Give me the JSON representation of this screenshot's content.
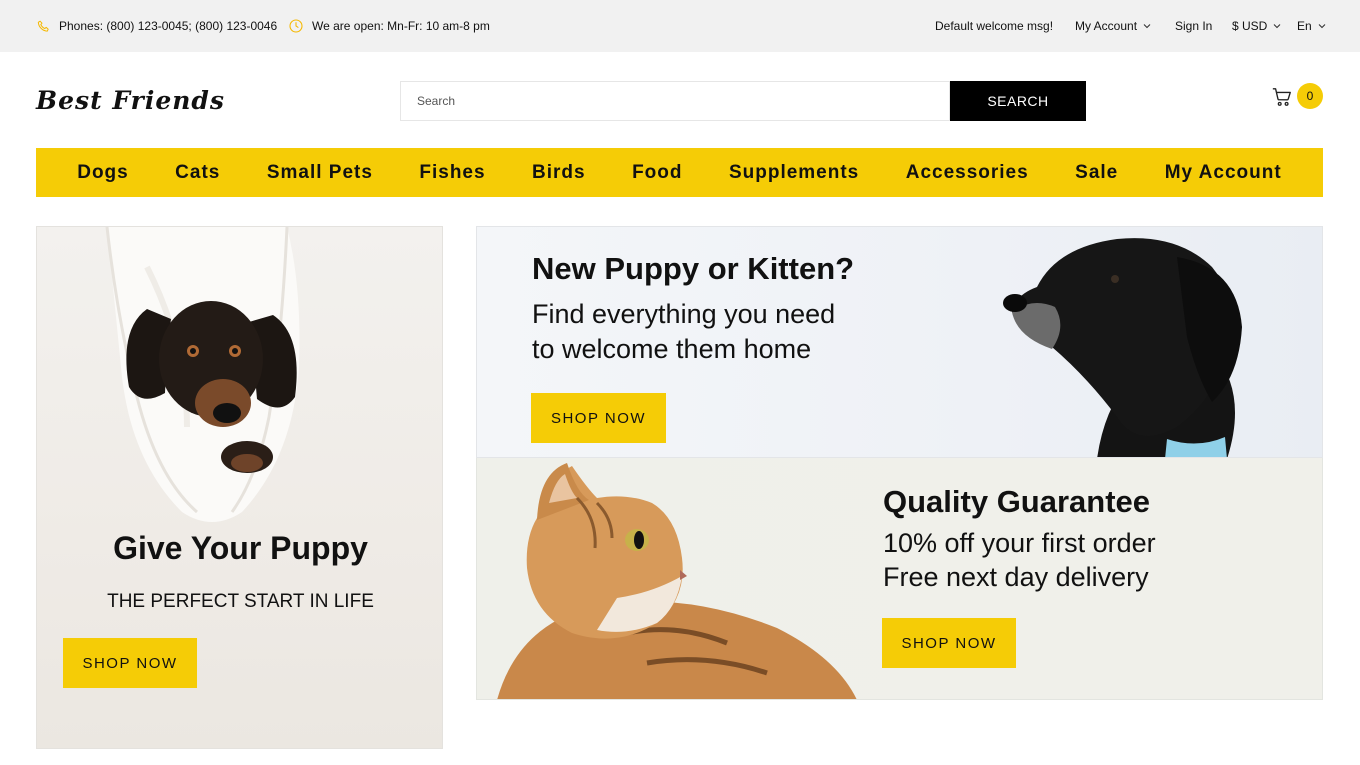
{
  "topbar": {
    "phones": "Phones: (800) 123-0045; (800) 123-0046",
    "hours": "We are open: Mn-Fr: 10 am-8 pm",
    "welcome": "Default welcome msg!",
    "my_account": "My Account",
    "sign_in": "Sign In",
    "currency": "$ USD",
    "language": "En"
  },
  "header": {
    "logo": "Best Friends",
    "search_placeholder": "Search",
    "search_button": "SEARCH",
    "cart_count": "0"
  },
  "nav": {
    "items": [
      "Dogs",
      "Cats",
      "Small Pets",
      "Fishes",
      "Birds",
      "Food",
      "Supplements",
      "Accessories",
      "Sale",
      "My Account"
    ]
  },
  "banners": {
    "left": {
      "title": "Give Your Puppy",
      "subtitle": "THE PERFECT START IN LIFE",
      "button": "SHOP NOW"
    },
    "top": {
      "title": "New Puppy or Kitten?",
      "line1": "Find everything you need",
      "line2": "to welcome them home",
      "button": "SHOP NOW"
    },
    "bottom": {
      "title": "Quality Guarantee",
      "line1": "10% off your first order",
      "line2": "Free next day delivery",
      "button": "SHOP NOW"
    }
  },
  "colors": {
    "accent": "#f5cc06",
    "topbar_bg": "#f1f1f1",
    "search_button_bg": "#000000"
  }
}
